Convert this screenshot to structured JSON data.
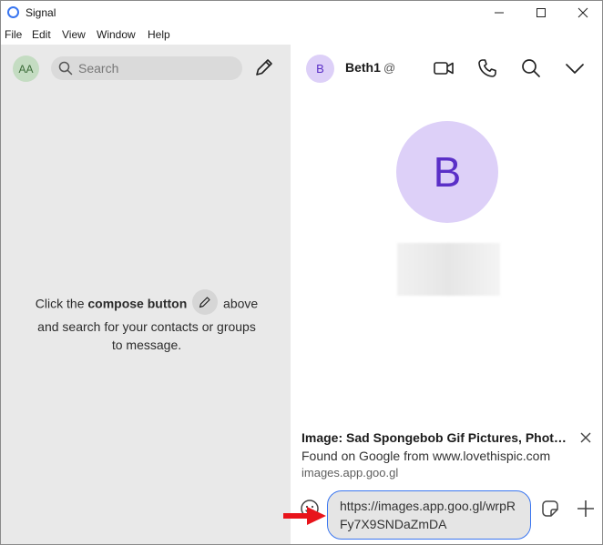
{
  "window": {
    "title": "Signal",
    "controls": [
      "minimize",
      "maximize",
      "close"
    ]
  },
  "menu": {
    "items": [
      {
        "label": "File"
      },
      {
        "label": "Edit"
      },
      {
        "label": "View"
      },
      {
        "label": "Window"
      },
      {
        "label": "Help"
      }
    ]
  },
  "sidebar": {
    "profile_initials": "AA",
    "search_placeholder": "Search",
    "empty_state": {
      "prefix": "Click the ",
      "bold": "compose button",
      "suffix_line1": " above",
      "line2": "and search for your contacts or groups",
      "line3": "to message."
    }
  },
  "conversation": {
    "contact_initial": "B",
    "contact_name": "Beth1",
    "contact_suffix": "@",
    "big_avatar_initial": "B",
    "link_preview": {
      "title": "Image: Sad Spongebob Gif Pictures, Photo…",
      "description": "Found on Google from www.lovethispic.com",
      "domain": "images.app.goo.gl"
    },
    "composer_text": "https://images.app.goo.gl/wrpRFy7X9SNDaZmDA"
  },
  "colors": {
    "accent": "#3a76f0",
    "avatar_bg": "#ddd0f8",
    "avatar_fg": "#5a2fc7",
    "sidebar_bg": "#e9e9e9",
    "arrow": "#e8141b"
  }
}
